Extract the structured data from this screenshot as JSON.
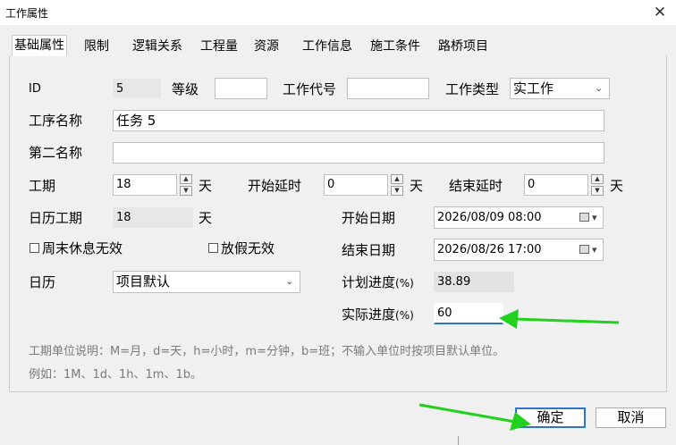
{
  "window": {
    "title": "工作属性",
    "close_glyph": "✕"
  },
  "tabs": [
    {
      "label": "基础属性",
      "active": true
    },
    {
      "label": "限制"
    },
    {
      "label": "逻辑关系"
    },
    {
      "label": "工程量"
    },
    {
      "label": "资源"
    },
    {
      "label": "工作信息"
    },
    {
      "label": "施工条件"
    },
    {
      "label": "路桥项目"
    }
  ],
  "form": {
    "id_label": "ID",
    "id_value": "5",
    "grade_label": "等级",
    "grade_value": "",
    "code_label": "工作代号",
    "code_value": "",
    "type_label": "工作类型",
    "type_value": "实工作",
    "name_label": "工序名称",
    "name_value": "任务 5",
    "second_name_label": "第二名称",
    "second_name_value": "",
    "duration_label": "工期",
    "duration_value": "18",
    "duration_unit": "天",
    "start_delay_label": "开始延时",
    "start_delay_value": "0",
    "start_delay_unit": "天",
    "end_delay_label": "结束延时",
    "end_delay_value": "0",
    "end_delay_unit": "天",
    "calendar_duration_label": "日历工期",
    "calendar_duration_value": "18",
    "calendar_duration_unit": "天",
    "start_date_label": "开始日期",
    "start_date_value": "2026/08/09 08:00",
    "weekend_invalid_label": "周末休息无效",
    "weekend_invalid_checked": false,
    "holiday_invalid_label": "放假无效",
    "holiday_invalid_checked": false,
    "end_date_label": "结束日期",
    "end_date_value": "2026/08/26 17:00",
    "calendar_label": "日历",
    "calendar_value": "项目默认",
    "planned_progress_label": "计划进度",
    "planned_progress_unit": "(%)",
    "planned_progress_value": "38.89",
    "actual_progress_label": "实际进度",
    "actual_progress_unit": "(%)",
    "actual_progress_value": "60"
  },
  "hints": {
    "line1": "工期单位说明：M=月，d=天，h=小时，m=分钟，b=班；不输入单位时按项目默认单位。",
    "line2": "例如：1M、1d、1h、1m、1b。"
  },
  "buttons": {
    "ok": "确定",
    "cancel": "取消"
  },
  "colors": {
    "accent_border": "#2f74c7",
    "annotation_arrow": "#22d11f"
  },
  "icons": {
    "dropdown": "chevron-down-icon",
    "calendar": "calendar-icon",
    "spin_up": "spin-up-icon",
    "spin_down": "spin-down-icon"
  },
  "glyphs": {
    "chevron": "⌄",
    "caret": "▾",
    "up": "▲",
    "down": "▼"
  }
}
